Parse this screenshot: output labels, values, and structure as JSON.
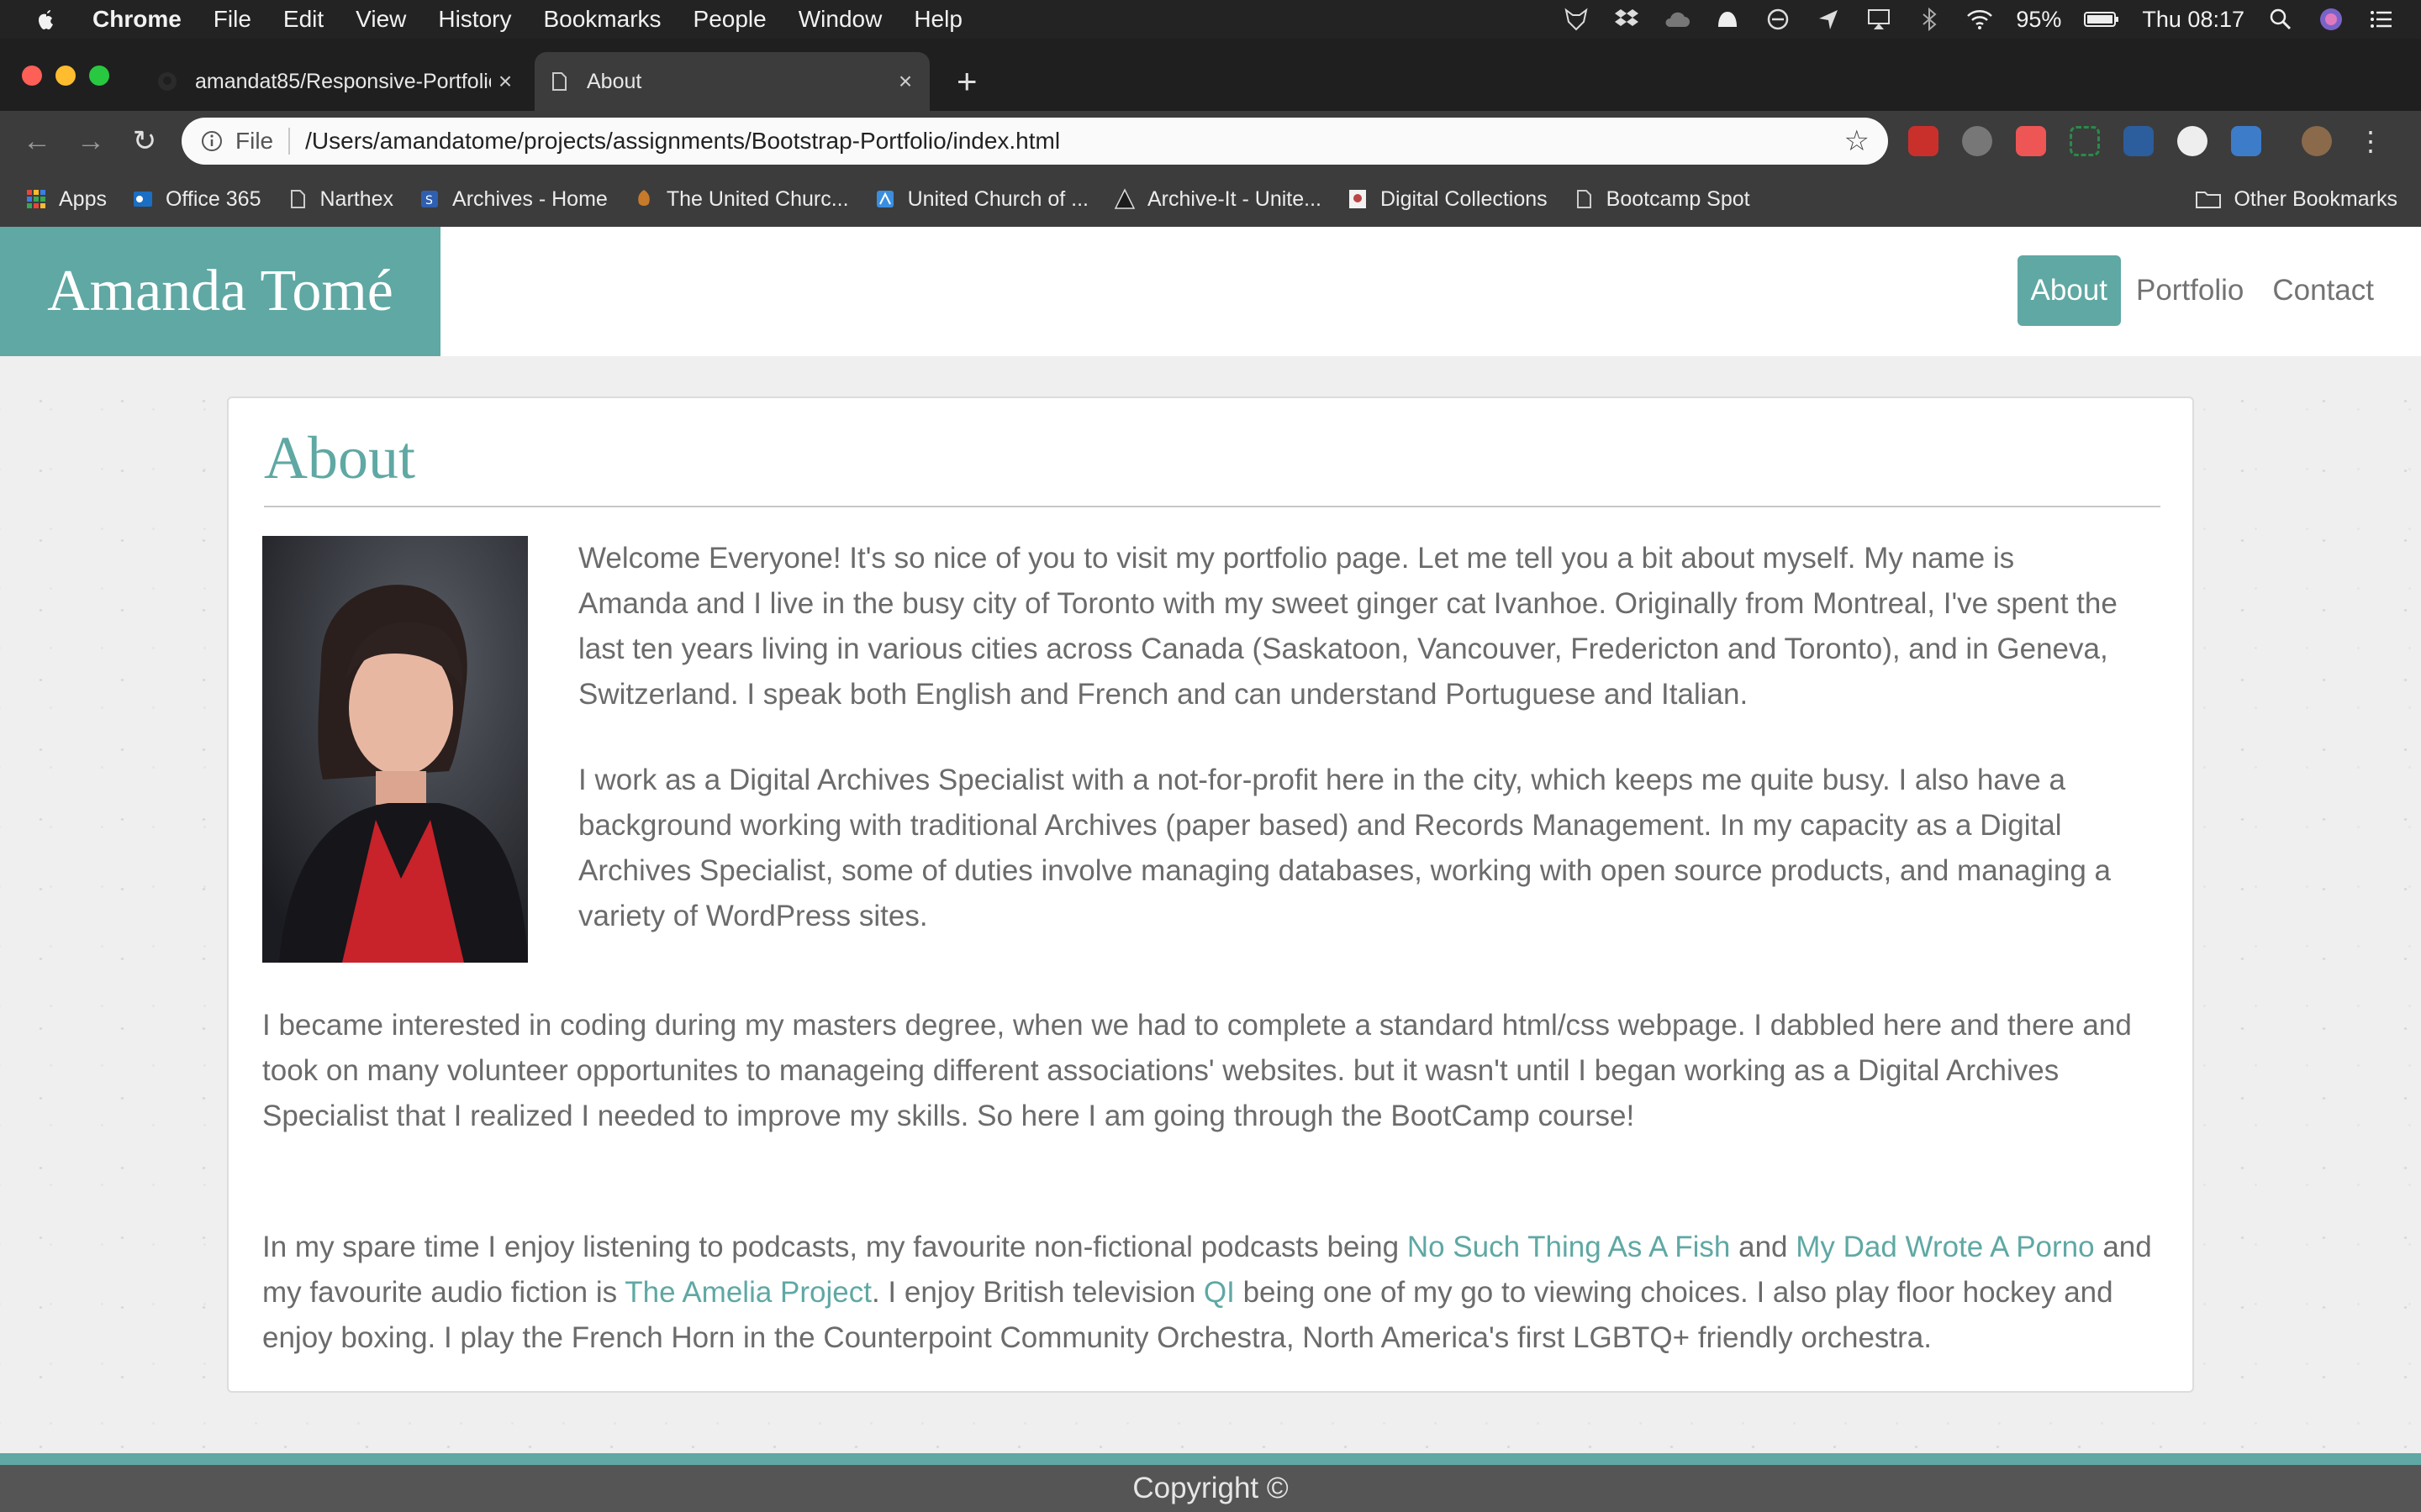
{
  "menubar": {
    "app": "Chrome",
    "items": [
      "File",
      "Edit",
      "View",
      "History",
      "Bookmarks",
      "People",
      "Window",
      "Help"
    ],
    "battery": "95%",
    "clock": "Thu 08:17"
  },
  "tabs": [
    {
      "title": "amandat85/Responsive-Portfolio",
      "close": "×"
    },
    {
      "title": "About",
      "close": "×"
    }
  ],
  "newtab": "+",
  "toolbar": {
    "scheme": "File",
    "url": "/Users/amandatome/projects/assignments/Bootstrap-Portfolio/index.html",
    "star": "☆"
  },
  "bookmarks": {
    "items": [
      "Apps",
      "Office 365",
      "Narthex",
      "Archives - Home",
      "The United Churc...",
      "United Church of ...",
      "Archive-It - Unite...",
      "Digital Collections",
      "Bootcamp Spot"
    ],
    "other": "Other Bookmarks"
  },
  "site": {
    "brand": "Amanda Tomé",
    "nav": [
      "About",
      "Portfolio",
      "Contact"
    ],
    "heading": "About",
    "p1": "Welcome Everyone! It's so nice of you to visit my portfolio page. Let me tell you a bit about myself. My name is Amanda and I live in the busy city of Toronto with my sweet ginger cat Ivanhoe. Originally from Montreal, I've spent the last ten years living in various cities across Canada (Saskatoon, Vancouver, Fredericton and Toronto), and in Geneva, Switzerland. I speak both English and French and can understand Portuguese and Italian.",
    "p2": "I work as a Digital Archives Specialist with a not-for-profit here in the city, which keeps me quite busy. I also have a background working with traditional Archives (paper based) and Records Management. In my capacity as a Digital Archives Specialist, some of duties involve managing databases, working with open source products, and managing a variety of WordPress sites.",
    "p3": "I became interested in coding during my masters degree, when we had to complete a standard html/css webpage. I dabbled here and there and took on many volunteer opportunites to manageing different associations' websites. but it wasn't until I began working as a Digital Archives Specialist that I realized I needed to improve my skills. So here I am going through the BootCamp course!",
    "p4": {
      "t1": "In my spare time I enjoy listening to podcasts, my favourite non-fictional podcasts being ",
      "link1": "No Such Thing As A Fish",
      "t2": " and ",
      "link2": "My Dad Wrote A Porno",
      "t3": " and my favourite audio fiction is ",
      "link3": "The Amelia Project",
      "t4": ". I enjoy British television ",
      "link4": "QI",
      "t5": " being one of my go to viewing choices. I also play floor hockey and enjoy boxing. I play the French Horn in the Counterpoint Community Orchestra, North America's first LGBTQ+ friendly orchestra."
    },
    "footer": "Copyright ©"
  },
  "colors": {
    "accent": "#5fa8a4",
    "text": "#6b6b6b",
    "footer": "#555555"
  }
}
